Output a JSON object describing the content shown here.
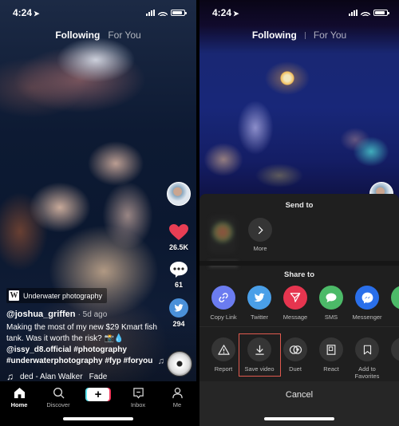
{
  "status_bar": {
    "time": "4:24",
    "location_icon": "location-arrow-icon",
    "battery_level": 0.85
  },
  "top_tabs": {
    "following": "Following",
    "for_you": "For You",
    "active": "Following"
  },
  "left": {
    "side_actions": {
      "likes": "26.5K",
      "comments": "61",
      "shares": "294"
    },
    "topic_tag": {
      "icon": "W",
      "label": "Underwater photography"
    },
    "username": "@joshua_griffen",
    "age": "· 5d ago",
    "description": "Making the most of my new $29 Kmart fish tank. Was it worth the risk? 📸💧",
    "mention_and_tags_line1": "@issy_d8.official #photography",
    "mention_and_tags_line2": "#underwaterphotography #fyp #foryou",
    "sound": {
      "title": "ded - Alan Walker",
      "title2": "Fade"
    }
  },
  "bottom_nav": {
    "items": [
      {
        "label": "Home",
        "icon": "home-icon",
        "active": true
      },
      {
        "label": "Discover",
        "icon": "search-icon",
        "active": false
      },
      {
        "label": "",
        "icon": "create-plus-icon",
        "active": false
      },
      {
        "label": "Inbox",
        "icon": "inbox-icon",
        "active": false
      },
      {
        "label": "Me",
        "icon": "profile-icon",
        "active": false
      }
    ],
    "create_symbol": "+"
  },
  "share_sheet": {
    "send_to_title": "Send to",
    "more_label": "More",
    "share_to_title": "Share to",
    "share_targets": [
      {
        "label": "Copy Link",
        "icon": "link-icon",
        "color": "#6b7cf0"
      },
      {
        "label": "Twitter",
        "icon": "twitter-icon",
        "color": "#4a9fe8"
      },
      {
        "label": "Message",
        "icon": "send-icon",
        "color": "#e6354f"
      },
      {
        "label": "SMS",
        "icon": "sms-icon",
        "color": "#4cba68"
      },
      {
        "label": "Messenger",
        "icon": "messenger-icon",
        "color": "#2a6fea"
      },
      {
        "label": "W",
        "icon": "whatsapp-icon",
        "color": "#4cba68"
      }
    ],
    "actions": [
      {
        "label": "Report",
        "icon": "warning-icon"
      },
      {
        "label": "Save video",
        "icon": "download-icon",
        "highlighted": true
      },
      {
        "label": "Duet",
        "icon": "duet-icon"
      },
      {
        "label": "React",
        "icon": "react-icon"
      },
      {
        "label": "Add to\nFavorites",
        "label_line1": "Add to",
        "label_line2": "Favorites",
        "icon": "bookmark-icon"
      },
      {
        "label": "Li",
        "icon": "live-photo-icon"
      }
    ],
    "cancel_label": "Cancel",
    "highlight_color": "#e05a4e"
  }
}
